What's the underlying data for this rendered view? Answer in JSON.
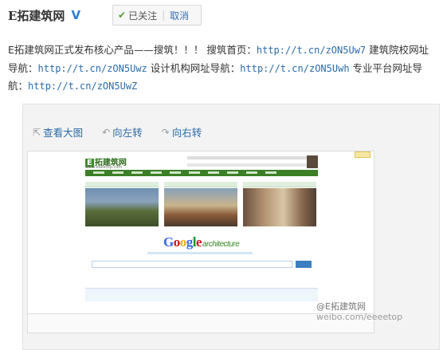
{
  "user": {
    "name": "E拓建筑网",
    "verified_icon": "verified-v-icon"
  },
  "follow": {
    "status_label": "已关注",
    "separator": "|",
    "cancel_label": "取消"
  },
  "post": {
    "text1": "E拓建筑网正式发布核心产品——搜筑！！！ 搜筑首页：",
    "link1": "http://t.cn/zON5Uw7",
    "text2": " 建筑院校网址导航：",
    "link2": "http://t.cn/zON5Uwz",
    "text3": " 设计机构网址导航：",
    "link3": "http://t.cn/zON5Uwh",
    "text4": " 专业平台网址导航：",
    "link4": "http://t.cn/zON5UwZ"
  },
  "media_tools": {
    "view_large": "查看大图",
    "rotate_left": "向左转",
    "rotate_right": "向右转"
  },
  "screenshot": {
    "logo_e": "E",
    "logo_text": "拓建筑网",
    "logo_sub": "www.eeeetop.com",
    "google": {
      "G": "G",
      "o1": "o",
      "o2": "o",
      "g": "g",
      "l": "l",
      "e": "e",
      "suffix": "architecture"
    },
    "colors": {
      "green": "#3c8a28",
      "blue": "#3c7fc0"
    }
  },
  "watermark": {
    "line1": "@E拓建筑网",
    "line2": "weibo.com/eeeetop"
  }
}
